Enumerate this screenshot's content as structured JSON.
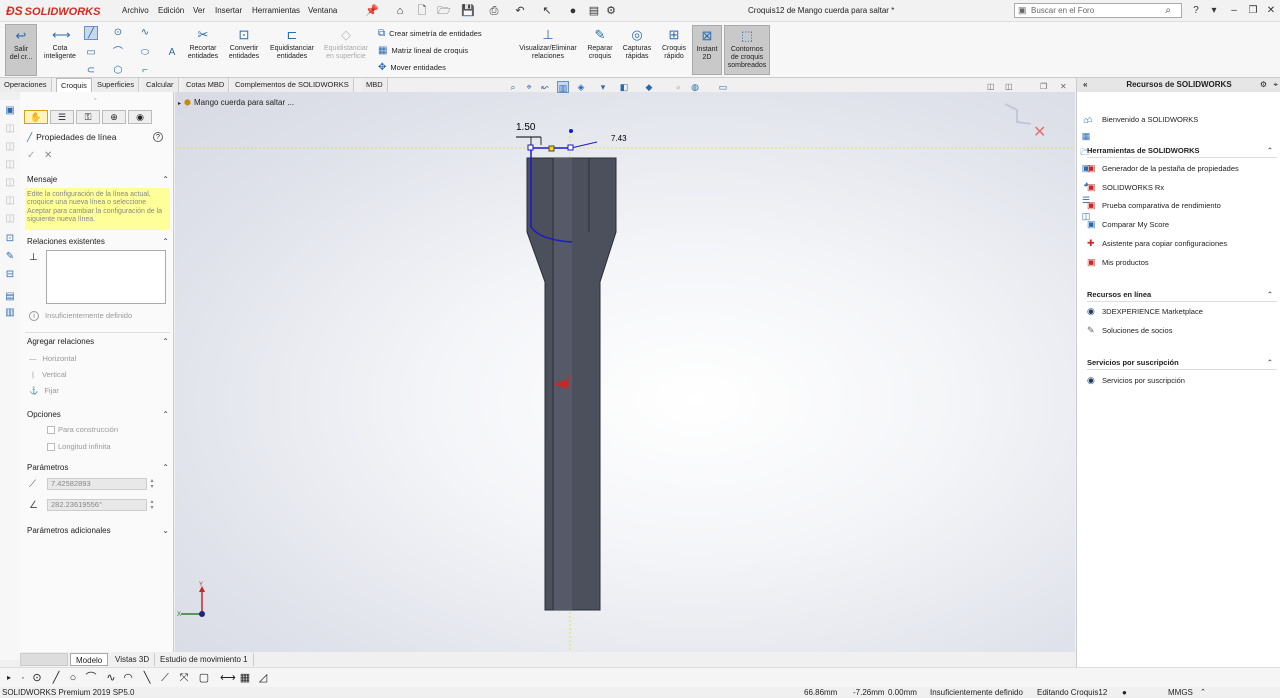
{
  "app": {
    "logo_text": "SOLIDWORKS",
    "doc_title": "Croquis12 de Mango cuerda para saltar *"
  },
  "menu": [
    "Archivo",
    "Edición",
    "Ver",
    "Insertar",
    "Herramientas",
    "Ventana"
  ],
  "search": {
    "placeholder": "Buscar en el Foro"
  },
  "ribbon": {
    "exit_sketch": "Salir\ndel cr...",
    "smart_dim": "Cota\ninteligente",
    "trim": "Recortar\nentidades",
    "convert": "Convertir\nentidades",
    "offset": "Equidistanciar\nentidades",
    "offset_surface": "Equidistanciar\nen superficie",
    "mirror": "Crear simetría de entidades",
    "linear_pattern": "Matriz lineal de croquis",
    "move": "Mover entidades",
    "relations": "Visualizar/Eliminar\nrelaciones",
    "repair": "Reparar\ncroquis",
    "quick_snaps": "Capturas\nrápidas",
    "rapid_sketch": "Croquis\nrápido",
    "instant2d": "Instant\n2D",
    "shaded": "Contornos\nde croquis\nsombreados"
  },
  "tabs": [
    "Operaciones",
    "Croquis",
    "Superficies",
    "Calcular",
    "Cotas MBD",
    "Complementos de SOLIDWORKS",
    "MBD"
  ],
  "active_tab": "Croquis",
  "property_manager": {
    "title": "Propiedades de línea",
    "message_head": "Mensaje",
    "message_text": "Edite la configuración de la línea actual, croquice una nueva línea o seleccione Aceptar para cambiar la configuración de la siguiente nueva línea.",
    "existing_relations_head": "Relaciones existentes",
    "status_text": "Insuficientemente definido",
    "add_relations_head": "Agregar relaciones",
    "rel_horizontal": "Horizontal",
    "rel_vertical": "Vertical",
    "rel_fix": "Fijar",
    "options_head": "Opciones",
    "opt_construction": "Para construcción",
    "opt_infinite": "Longitud infinita",
    "params_head": "Parámetros",
    "param_length": "7.42582893",
    "param_angle": "282.23619556°",
    "extra_params_head": "Parámetros adicionales"
  },
  "tree": {
    "root_label": "Mango cuerda para saltar ..."
  },
  "viewport": {
    "dim_1": "1.50",
    "dim_2": "7.43"
  },
  "task_pane": {
    "title": "Recursos de SOLIDWORKS",
    "welcome": "Bienvenido a SOLIDWORKS",
    "tools_head": "Herramientas de SOLIDWORKS",
    "tools": [
      "Generador de la pestaña de propiedades",
      "SOLIDWORKS Rx",
      "Prueba comparativa de rendimiento",
      "Comparar My Score",
      "Asistente para copiar configuraciones",
      "Mis productos"
    ],
    "online_head": "Recursos en línea",
    "online": [
      "3DEXPERIENCE Marketplace",
      "Soluciones de socios"
    ],
    "subscription_head": "Servicios por suscripción",
    "subscription": [
      "Servicios por suscripción"
    ]
  },
  "bottom_tabs": [
    "Modelo",
    "Vistas 3D",
    "Estudio de movimiento 1"
  ],
  "active_bottom_tab": "Modelo",
  "status": {
    "product": "SOLIDWORKS Premium 2019 SP5.0",
    "x": "66.86mm",
    "y": "-7.26mm",
    "z": "0.00mm",
    "definition": "Insuficientemente definido",
    "editing": "Editando Croquis12",
    "units": "MMGS"
  }
}
